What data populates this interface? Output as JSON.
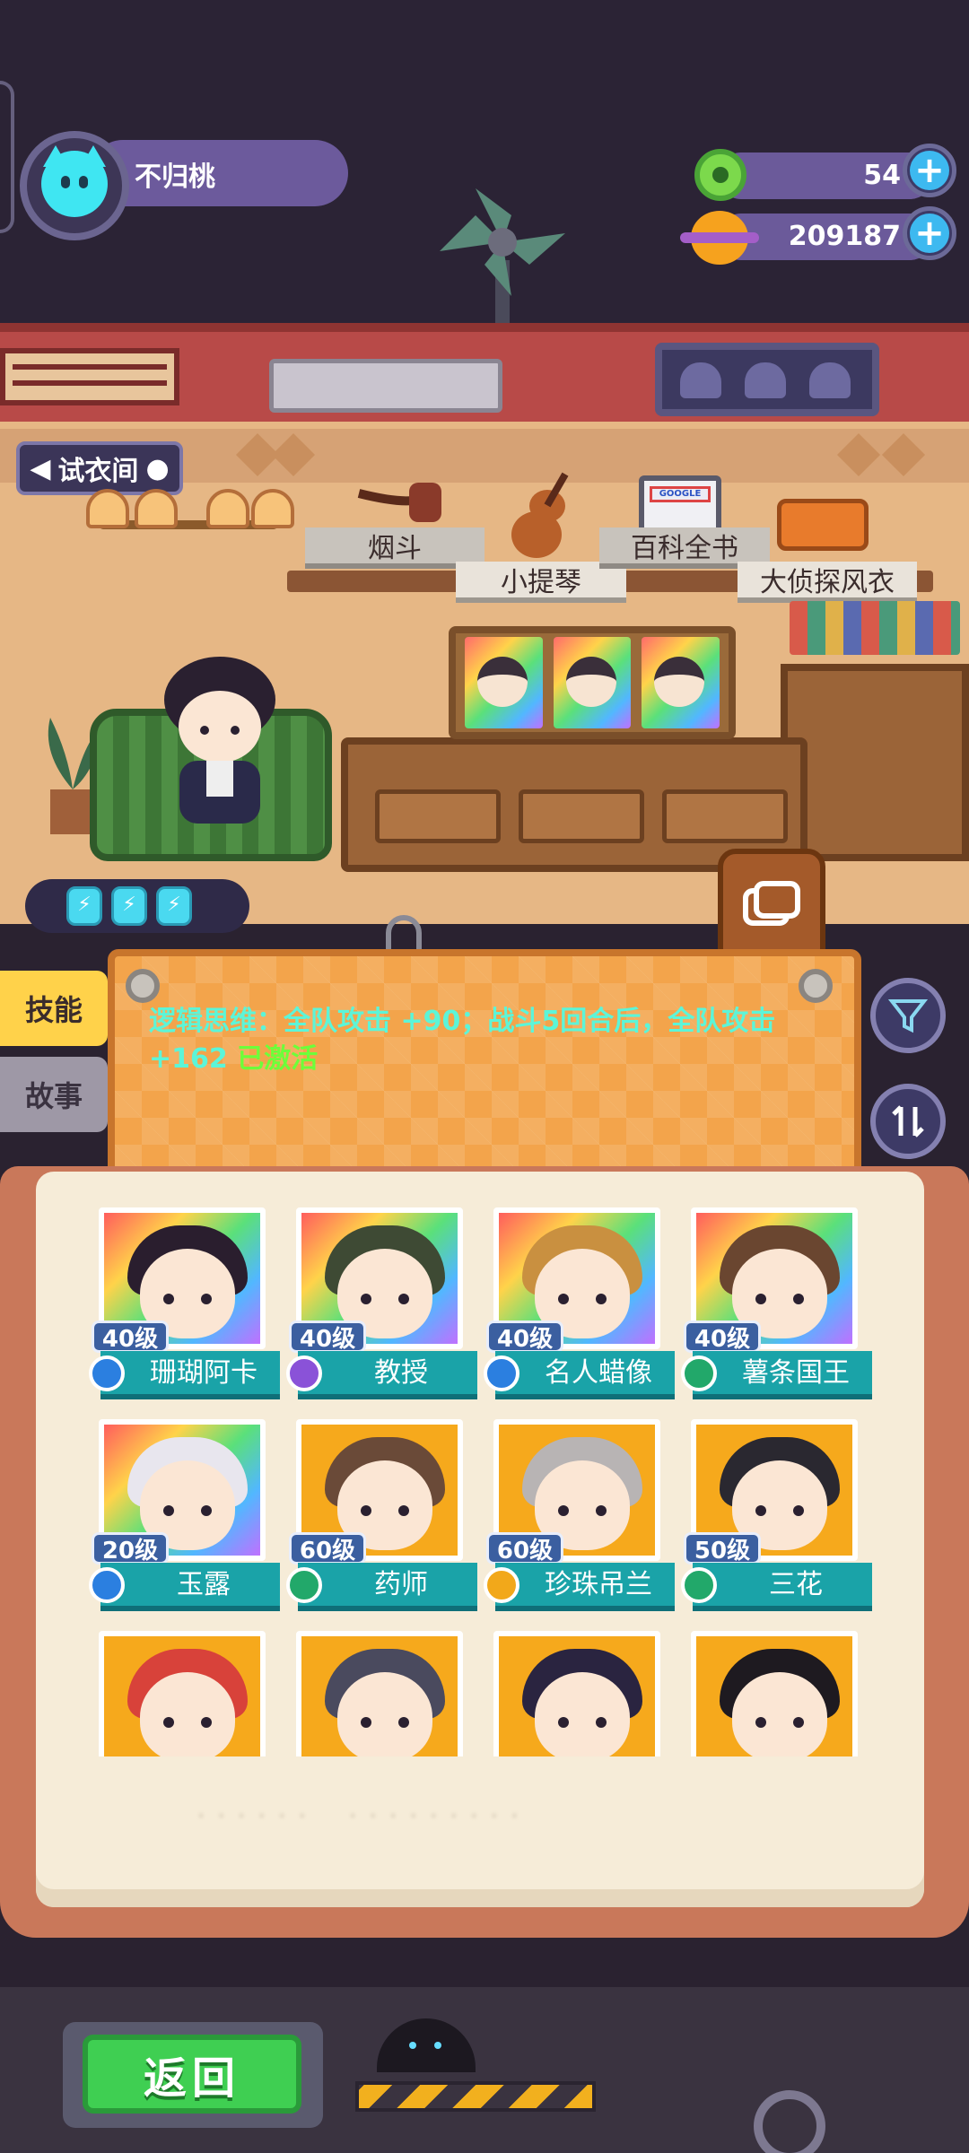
{
  "player": {
    "name": "不归桃"
  },
  "currency": {
    "gems": "54",
    "coins": "209187",
    "plus": "+"
  },
  "room": {
    "fitting_room_label": "试衣间",
    "items": [
      "烟斗",
      "小提琴",
      "百科全书",
      "大侦探风衣"
    ],
    "book_logo": "GOOGLE"
  },
  "energy": [
    "⚡",
    "⚡",
    "⚡"
  ],
  "tabs": {
    "skill": "技能",
    "story": "故事"
  },
  "skill": {
    "description": "逻辑思维：全队攻击 +90；战斗5回合后，全队攻击 +162",
    "status": "已激活"
  },
  "characters": [
    {
      "level": "40级",
      "name": "珊瑚阿卡",
      "art": "rainbow",
      "role_color": "#2b7fe0",
      "hair": "#2a1e2e"
    },
    {
      "level": "40级",
      "name": "教授",
      "art": "rainbow",
      "role_color": "#8a52d8",
      "hair": "#3e4a34"
    },
    {
      "level": "40级",
      "name": "名人蜡像",
      "art": "rainbow",
      "role_color": "#2b7fe0",
      "hair": "#c99040"
    },
    {
      "level": "40级",
      "name": "薯条国王",
      "art": "rainbow",
      "role_color": "#22a86a",
      "hair": "#6a4630"
    },
    {
      "level": "20级",
      "name": "玉露",
      "art": "rainbow",
      "role_color": "#2b7fe0",
      "hair": "#e8e6ee"
    },
    {
      "level": "60级",
      "name": "药师",
      "art": "gold",
      "role_color": "#22a86a",
      "hair": "#6a4a38"
    },
    {
      "level": "60级",
      "name": "珍珠吊兰",
      "art": "gold",
      "role_color": "#f2a81a",
      "hair": "#b8b4b4"
    },
    {
      "level": "50级",
      "name": "三花",
      "art": "gold",
      "role_color": "#22a86a",
      "hair": "#2a2830"
    },
    {
      "level": "",
      "name": "",
      "art": "gold",
      "role_color": "#2b7fe0",
      "hair": "#d8423a"
    },
    {
      "level": "",
      "name": "",
      "art": "gold",
      "role_color": "#2b7fe0",
      "hair": "#4a4a5e"
    },
    {
      "level": "",
      "name": "",
      "art": "gold",
      "role_color": "#2b7fe0",
      "hair": "#2a2440"
    },
    {
      "level": "",
      "name": "",
      "art": "gold",
      "role_color": "#2b7fe0",
      "hair": "#1e1a20"
    }
  ],
  "buttons": {
    "back": "返回"
  },
  "colors": {
    "skill_text": "#5cf5d8",
    "active": "#6dff3a",
    "name_bar": "#1aa3a8",
    "back_button": "#3fcf52"
  },
  "icons": [
    "cat-avatar-icon",
    "donut-gem-icon",
    "planet-coin-icon",
    "plus-icon",
    "filter-icon",
    "sort-icon",
    "wardrobe-icon",
    "energy-icon",
    "shield-role-icon"
  ]
}
